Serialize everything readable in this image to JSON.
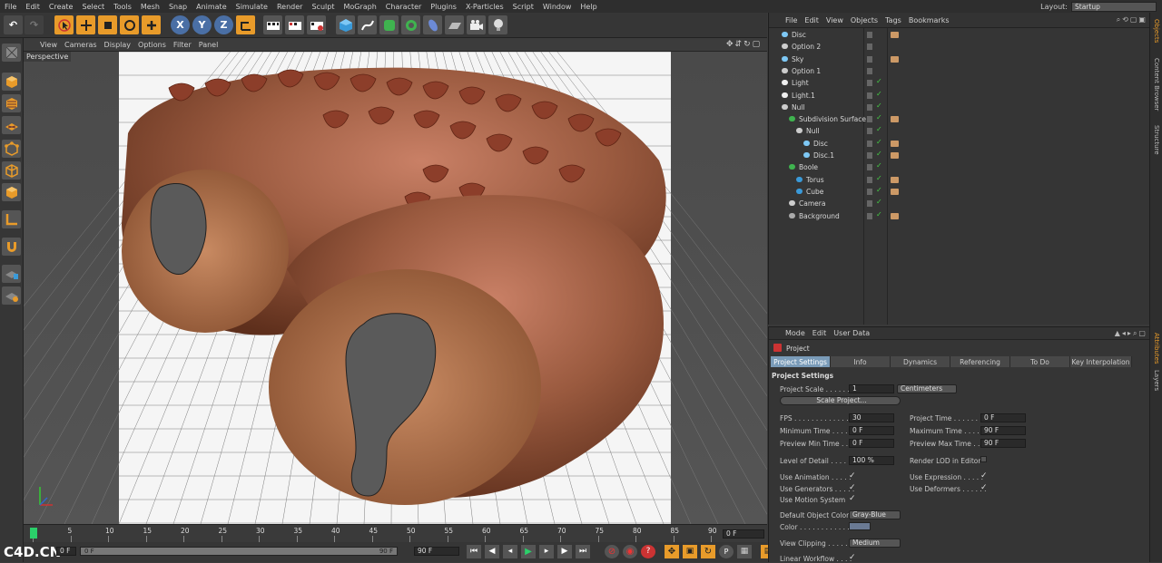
{
  "menu": [
    "File",
    "Edit",
    "Create",
    "Select",
    "Tools",
    "Mesh",
    "Snap",
    "Animate",
    "Simulate",
    "Render",
    "Sculpt",
    "MoGraph",
    "Character",
    "Plugins",
    "X-Particles",
    "Script",
    "Window",
    "Help"
  ],
  "layout": {
    "label": "Layout:",
    "value": "Startup"
  },
  "viewport": {
    "menu": [
      "View",
      "Cameras",
      "Display",
      "Options",
      "Filter",
      "Panel"
    ],
    "label": "Perspective"
  },
  "timeline": {
    "ticks": [
      "0",
      "5",
      "10",
      "15",
      "20",
      "25",
      "30",
      "35",
      "40",
      "45",
      "50",
      "55",
      "60",
      "65",
      "70",
      "75",
      "80",
      "85",
      "90"
    ],
    "current_frame": "0 F",
    "min_field": "0 F",
    "range_start": "0 F",
    "range_end": "90 F",
    "max_field": "90 F"
  },
  "watermark": "C4D.CN",
  "objects": {
    "menu": [
      "File",
      "Edit",
      "View",
      "Objects",
      "Tags",
      "Bookmarks"
    ],
    "rows": [
      {
        "name": "Disc",
        "indent": 0
      },
      {
        "name": "Option 2",
        "indent": 0
      },
      {
        "name": "Sky",
        "indent": 0
      },
      {
        "name": "Option 1",
        "indent": 0
      },
      {
        "name": "Light",
        "indent": 0
      },
      {
        "name": "Light.1",
        "indent": 0
      },
      {
        "name": "Null",
        "indent": 0
      },
      {
        "name": "Subdivision Surface",
        "indent": 1
      },
      {
        "name": "Null",
        "indent": 2
      },
      {
        "name": "Disc",
        "indent": 3
      },
      {
        "name": "Disc.1",
        "indent": 3
      },
      {
        "name": "Boole",
        "indent": 1
      },
      {
        "name": "Torus",
        "indent": 2
      },
      {
        "name": "Cube",
        "indent": 2
      },
      {
        "name": "Camera",
        "indent": 1
      },
      {
        "name": "Background",
        "indent": 1
      }
    ]
  },
  "attributes": {
    "menu": [
      "Mode",
      "Edit",
      "User Data"
    ],
    "object": "Project",
    "tabs": [
      "Project Settings",
      "Info",
      "Dynamics",
      "Referencing",
      "To Do",
      "Key Interpolation"
    ],
    "section": "Project Settings",
    "project_scale": {
      "label": "Project Scale . . . . . .",
      "value": "1",
      "unit": "Centimeters"
    },
    "scale_button": "Scale Project...",
    "fps": {
      "label": "FPS . . . . . . . . . . . . . .",
      "value": "30"
    },
    "project_time": {
      "label": "Project Time . . . . . . .",
      "value": "0 F"
    },
    "min_time": {
      "label": "Minimum Time . . . . . .",
      "value": "0 F"
    },
    "max_time": {
      "label": "Maximum Time . . . . . .",
      "value": "90 F"
    },
    "preview_min": {
      "label": "Preview Min Time . . .",
      "value": "0 F"
    },
    "preview_max": {
      "label": "Preview Max Time . . .",
      "value": "90 F"
    },
    "lod": {
      "label": "Level of Detail . . . . . .",
      "value": "100 %"
    },
    "render_lod": "Render LOD in Editor",
    "use_animation": "Use Animation . . . . .",
    "use_expression": "Use Expression . . . . .",
    "use_generators": "Use Generators . . . . .",
    "use_deformers": "Use Deformers . . . . . .",
    "use_motion": "Use Motion System",
    "default_color": {
      "label": "Default Object Color",
      "value": "Gray-Blue"
    },
    "color_label": "Color . . . . . . . . . . . .",
    "view_clipping": {
      "label": "View Clipping . . . . . .",
      "value": "Medium"
    },
    "linear_workflow": "Linear Workflow . . . ."
  },
  "sidetabs": [
    "Objects",
    "Content Browser",
    "Structure",
    "Attributes",
    "Layers"
  ]
}
